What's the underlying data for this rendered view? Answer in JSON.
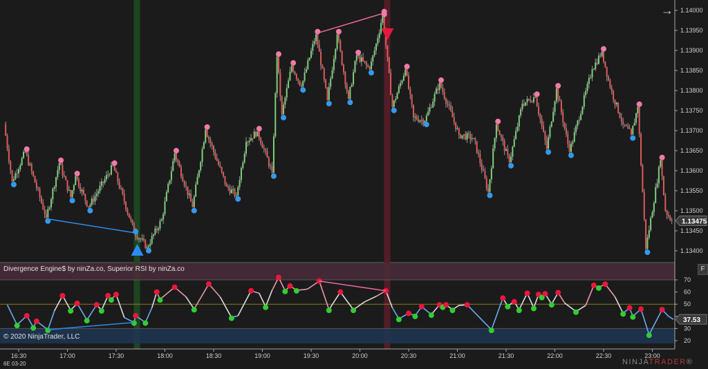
{
  "indicator_title": "Divergence Engine$ by ninZa.co, Superior RSI by ninZa.co",
  "copyright": "© 2020 NinjaTrader, LLC",
  "instrument": "6E 03-20",
  "logo": {
    "part1": "NINJA",
    "part2": "TRADER",
    "reg": "®"
  },
  "f_button": "F",
  "scroll_arrow_icon": "arrow-right-icon",
  "colors": {
    "background": "#1b1b1b",
    "up_candle": "#7ed07e",
    "down_candle": "#e05a5a",
    "wick": "#9a9a9a",
    "pivot_high": "#f07aa8",
    "pivot_low": "#3399ee",
    "rsi_high": "#e8183c",
    "rsi_low": "#33cc33",
    "bull_div": "#2b8cf0",
    "bear_div": "#f06aa0",
    "bull_band": "#1f4a22",
    "bear_band": "#5a1e2a",
    "overbought_zone": "#4a2c3a",
    "oversold_zone": "#1e3550"
  },
  "price_axis": {
    "ticks": [
      "1.14000",
      "1.13950",
      "1.13900",
      "1.13850",
      "1.13800",
      "1.13750",
      "1.13700",
      "1.13650",
      "1.13600",
      "1.13550",
      "1.13500",
      "1.13450",
      "1.13400"
    ],
    "last_price": "1.13475"
  },
  "rsi_axis": {
    "ticks": [
      "70",
      "60",
      "50",
      "40",
      "30",
      "20"
    ],
    "last_value": "37.53",
    "overbought": 70,
    "midline": 50,
    "oversold": 30
  },
  "time_axis": {
    "ticks": [
      "16:30",
      "17:00",
      "17:30",
      "18:00",
      "18:30",
      "19:00",
      "19:30",
      "20:00",
      "20:30",
      "21:00",
      "21:30",
      "22:00",
      "22:30",
      "23:00"
    ]
  },
  "chart_data": [
    {
      "type": "candlestick",
      "price_path": [
        [
          "16:22",
          1.13716
        ],
        [
          "16:27",
          1.13574
        ],
        [
          "16:35",
          1.13647
        ],
        [
          "16:48",
          1.13483
        ],
        [
          "16:56",
          1.13619
        ],
        [
          "17:03",
          1.13534
        ],
        [
          "17:06",
          1.13586
        ],
        [
          "17:14",
          1.13509
        ],
        [
          "17:29",
          1.13612
        ],
        [
          "17:42",
          1.13448
        ],
        [
          "17:50",
          1.13409
        ],
        [
          "17:59",
          1.13478
        ],
        [
          "18:07",
          1.13643
        ],
        [
          "18:18",
          1.13509
        ],
        [
          "18:26",
          1.13702
        ],
        [
          "18:39",
          1.1356
        ],
        [
          "18:45",
          1.13538
        ],
        [
          "18:51",
          1.13672
        ],
        [
          "18:58",
          1.13698
        ],
        [
          "19:07",
          1.13595
        ],
        [
          "19:10",
          1.13884
        ],
        [
          "19:13",
          1.13741
        ],
        [
          "19:19",
          1.13862
        ],
        [
          "19:25",
          1.1381
        ],
        [
          "19:34",
          1.1394
        ],
        [
          "19:41",
          1.13776
        ],
        [
          "19:47",
          1.1394
        ],
        [
          "19:54",
          1.13779
        ],
        [
          "19:59",
          1.13888
        ],
        [
          "20:07",
          1.13853
        ],
        [
          "20:12",
          1.13931
        ],
        [
          "20:15",
          1.1399
        ],
        [
          "20:21",
          1.13759
        ],
        [
          "20:29",
          1.13853
        ],
        [
          "20:34",
          1.13733
        ],
        [
          "20:41",
          1.13724
        ],
        [
          "20:50",
          1.13819
        ],
        [
          "21:02",
          1.1369
        ],
        [
          "21:11",
          1.13681
        ],
        [
          "21:20",
          1.13547
        ],
        [
          "21:25",
          1.13716
        ],
        [
          "21:33",
          1.13621
        ],
        [
          "21:41",
          1.13767
        ],
        [
          "21:49",
          1.13784
        ],
        [
          "21:56",
          1.13655
        ],
        [
          "22:02",
          1.13805
        ],
        [
          "22:10",
          1.13647
        ],
        [
          "22:24",
          1.13853
        ],
        [
          "22:30",
          1.13897
        ],
        [
          "22:35",
          1.13807
        ],
        [
          "22:43",
          1.13716
        ],
        [
          "22:48",
          1.1369
        ],
        [
          "22:52",
          1.13759
        ],
        [
          "22:57",
          1.13405
        ],
        [
          "23:06",
          1.13626
        ],
        [
          "23:09",
          1.135
        ],
        [
          "23:13",
          1.13475
        ]
      ],
      "divergences": [
        {
          "kind": "bullish",
          "from": [
            "16:48",
            1.13483
          ],
          "to": [
            "17:42",
            1.13448
          ],
          "signal_time": "17:43"
        },
        {
          "kind": "bearish",
          "from": [
            "19:34",
            1.1394
          ],
          "to": [
            "20:15",
            1.1399
          ],
          "signal_time": "20:17"
        }
      ],
      "ylim": [
        1.13375,
        1.14025
      ]
    },
    {
      "type": "line",
      "rsi": [
        [
          "16:23",
          49.5
        ],
        [
          "16:29",
          33
        ],
        [
          "16:35",
          40.5
        ],
        [
          "16:39",
          31
        ],
        [
          "16:41",
          36
        ],
        [
          "16:48",
          29
        ],
        [
          "16:52",
          44.5
        ],
        [
          "16:57",
          57
        ],
        [
          "17:02",
          45
        ],
        [
          "17:06",
          50.7
        ],
        [
          "17:12",
          37
        ],
        [
          "17:18",
          49.5
        ],
        [
          "17:21",
          45
        ],
        [
          "17:25",
          57
        ],
        [
          "17:27",
          54
        ],
        [
          "17:30",
          58
        ],
        [
          "17:35",
          39
        ],
        [
          "17:41",
          35
        ],
        [
          "17:42",
          40.5
        ],
        [
          "17:48",
          35
        ],
        [
          "17:52",
          47
        ],
        [
          "17:55",
          60
        ],
        [
          "17:57",
          54
        ],
        [
          "18:06",
          64
        ],
        [
          "18:13",
          56
        ],
        [
          "18:18",
          46
        ],
        [
          "18:27",
          66.6
        ],
        [
          "18:34",
          56
        ],
        [
          "18:41",
          39
        ],
        [
          "18:45",
          40.5
        ],
        [
          "18:53",
          61
        ],
        [
          "18:58",
          59
        ],
        [
          "19:02",
          48
        ],
        [
          "19:06",
          61.5
        ],
        [
          "19:10",
          72
        ],
        [
          "19:14",
          61
        ],
        [
          "19:17",
          65
        ],
        [
          "19:21",
          61.5
        ],
        [
          "19:26",
          62
        ],
        [
          "19:28",
          62.6
        ],
        [
          "19:35",
          69
        ],
        [
          "19:41",
          45.5
        ],
        [
          "19:48",
          60
        ],
        [
          "19:56",
          45.5
        ],
        [
          "20:03",
          52
        ],
        [
          "20:10",
          56.4
        ],
        [
          "20:16",
          61
        ],
        [
          "20:20",
          47
        ],
        [
          "20:24",
          38
        ],
        [
          "20:30",
          42.5
        ],
        [
          "20:34",
          40.5
        ],
        [
          "20:38",
          48
        ],
        [
          "20:44",
          41.5
        ],
        [
          "20:49",
          49.5
        ],
        [
          "20:51",
          48
        ],
        [
          "20:53",
          49.5
        ],
        [
          "20:57",
          45.5
        ],
        [
          "21:01",
          49
        ],
        [
          "21:06",
          49.5
        ],
        [
          "21:21",
          29
        ],
        [
          "21:28",
          55
        ],
        [
          "21:31",
          48.5
        ],
        [
          "21:35",
          52
        ],
        [
          "21:38",
          45.5
        ],
        [
          "21:43",
          59
        ],
        [
          "21:47",
          47
        ],
        [
          "21:50",
          58
        ],
        [
          "21:52",
          56
        ],
        [
          "21:54",
          58.6
        ],
        [
          "21:58",
          50
        ],
        [
          "22:02",
          59.5
        ],
        [
          "22:06",
          51
        ],
        [
          "22:13",
          44
        ],
        [
          "22:19",
          49
        ],
        [
          "22:24",
          65.5
        ],
        [
          "22:27",
          63.8
        ],
        [
          "22:31",
          66.5
        ],
        [
          "22:37",
          56
        ],
        [
          "22:42",
          42.5
        ],
        [
          "22:46",
          47
        ],
        [
          "22:48",
          40
        ],
        [
          "22:53",
          46
        ],
        [
          "22:58",
          25
        ],
        [
          "23:06",
          45.5
        ],
        [
          "23:10",
          40
        ],
        [
          "23:13",
          37.53
        ]
      ],
      "divergences": [
        {
          "kind": "bullish",
          "from": [
            "16:48",
            29
          ],
          "to": [
            "17:41",
            35
          ]
        },
        {
          "kind": "bearish",
          "from": [
            "19:35",
            69
          ],
          "to": [
            "20:16",
            61
          ]
        }
      ],
      "ylim": [
        16,
        84
      ]
    }
  ]
}
